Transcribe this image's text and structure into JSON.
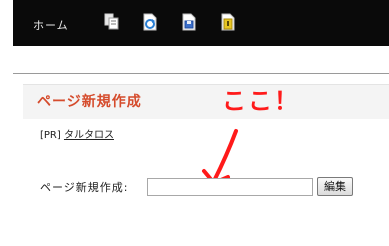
{
  "toolbar": {
    "home_label": "ホーム",
    "icons": [
      "copy-pages-icon",
      "refresh-page-icon",
      "save-page-icon",
      "lock-page-icon"
    ]
  },
  "page": {
    "heading": "ページ新規作成"
  },
  "annotation": {
    "text": "ここ！",
    "color": "#ff1a1a"
  },
  "pr": {
    "prefix": "[PR]",
    "link_text": "タルタロス"
  },
  "form": {
    "label": "ページ新規作成:",
    "input_value": "",
    "button_label": "編集"
  },
  "colors": {
    "toolbar_bg": "#0a0a0a",
    "heading_color": "#d54b2c",
    "heading_bg": "#f4f4f4"
  }
}
